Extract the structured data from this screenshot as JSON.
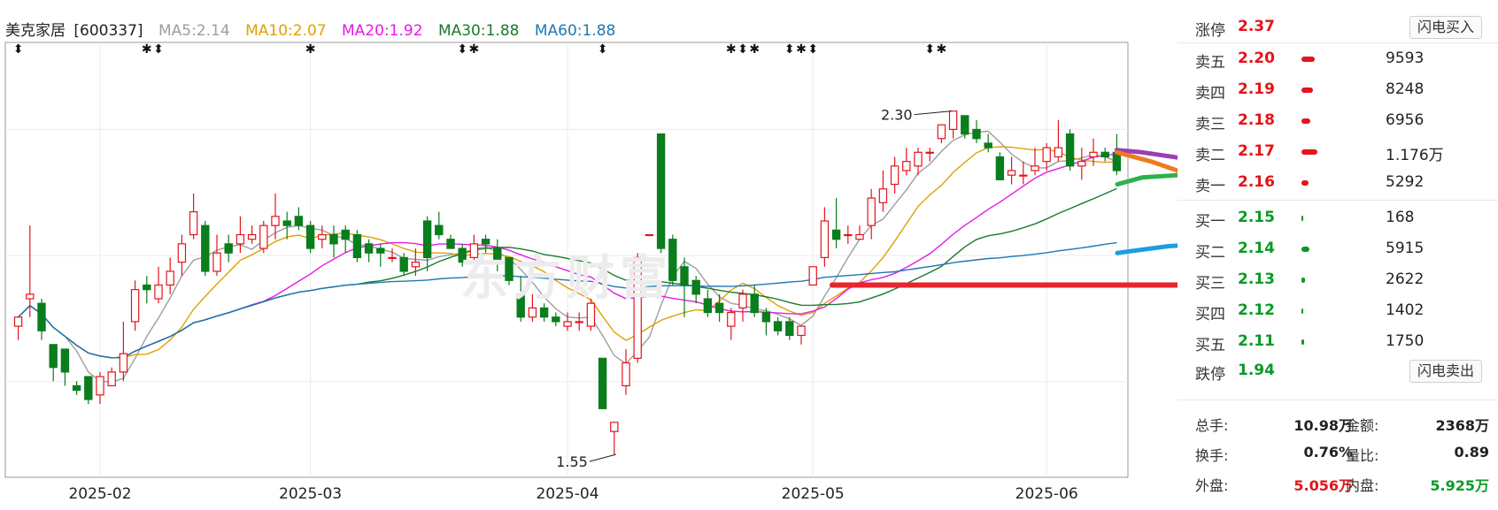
{
  "header": {
    "stock_name": "美克家居",
    "stock_code": "[600337]",
    "ma": [
      {
        "label": "MA5:2.14",
        "color": "#9e9e9e"
      },
      {
        "label": "MA10:2.07",
        "color": "#e0a000"
      },
      {
        "label": "MA20:1.92",
        "color": "#e619e6"
      },
      {
        "label": "MA30:1.88",
        "color": "#1a7a2a"
      },
      {
        "label": "MA60:1.88",
        "color": "#1f77b4"
      }
    ]
  },
  "watermark": "东方财富",
  "chart_data": {
    "type": "candlestick",
    "x_tick_labels": [
      "2025-02",
      "2025-03",
      "2025-04",
      "2025-05",
      "2025-06"
    ],
    "y_range": [
      1.5,
      2.45
    ],
    "annotations": [
      {
        "text": "2.30",
        "type": "high"
      },
      {
        "text": "1.55",
        "type": "low"
      }
    ],
    "candles": [
      [
        1.83,
        1.85,
        1.8,
        1.85
      ],
      [
        1.89,
        1.9,
        1.85,
        2.05
      ],
      [
        1.88,
        1.82,
        1.8,
        1.89
      ],
      [
        1.79,
        1.74,
        1.71,
        1.79
      ],
      [
        1.78,
        1.73,
        1.7,
        1.78
      ],
      [
        1.7,
        1.69,
        1.68,
        1.71
      ],
      [
        1.72,
        1.67,
        1.66,
        1.72
      ],
      [
        1.68,
        1.72,
        1.66,
        1.73
      ],
      [
        1.7,
        1.73,
        1.7,
        1.74
      ],
      [
        1.73,
        1.77,
        1.71,
        1.84
      ],
      [
        1.84,
        1.91,
        1.82,
        1.93
      ],
      [
        1.92,
        1.91,
        1.88,
        1.94
      ],
      [
        1.89,
        1.92,
        1.88,
        1.96
      ],
      [
        1.92,
        1.95,
        1.9,
        1.98
      ],
      [
        1.97,
        2.01,
        1.94,
        2.03
      ],
      [
        2.03,
        2.08,
        2.02,
        2.12
      ],
      [
        2.05,
        1.95,
        1.94,
        2.06
      ],
      [
        1.95,
        1.99,
        1.94,
        2.03
      ],
      [
        2.01,
        1.99,
        1.97,
        2.03
      ],
      [
        2.01,
        2.03,
        1.99,
        2.07
      ],
      [
        2.02,
        2.03,
        2.01,
        2.05
      ],
      [
        2.0,
        2.05,
        1.99,
        2.06
      ],
      [
        2.05,
        2.07,
        2.02,
        2.12
      ],
      [
        2.06,
        2.05,
        2.02,
        2.08
      ],
      [
        2.07,
        2.05,
        2.04,
        2.09
      ],
      [
        2.05,
        2.0,
        1.99,
        2.06
      ],
      [
        2.02,
        2.03,
        2.0,
        2.05
      ],
      [
        2.03,
        2.01,
        1.98,
        2.05
      ],
      [
        2.04,
        2.02,
        1.99,
        2.05
      ],
      [
        2.03,
        1.98,
        1.97,
        2.04
      ],
      [
        2.01,
        1.99,
        1.97,
        2.02
      ],
      [
        2.0,
        1.99,
        1.96,
        2.01
      ],
      [
        1.98,
        1.98,
        1.97,
        2.0
      ],
      [
        1.98,
        1.95,
        1.94,
        1.99
      ],
      [
        1.96,
        1.97,
        1.94,
        2.0
      ],
      [
        2.06,
        1.98,
        1.95,
        2.07
      ],
      [
        2.05,
        2.03,
        2.02,
        2.08
      ],
      [
        2.02,
        2.0,
        2.0,
        2.03
      ],
      [
        2.0,
        1.97,
        1.96,
        2.01
      ],
      [
        1.98,
        2.01,
        1.97,
        2.03
      ],
      [
        2.02,
        2.01,
        1.99,
        2.03
      ],
      [
        2.0,
        1.97,
        1.95,
        2.02
      ],
      [
        1.98,
        1.93,
        1.92,
        1.98
      ],
      [
        1.9,
        1.85,
        1.84,
        1.94
      ],
      [
        1.85,
        1.87,
        1.84,
        1.9
      ],
      [
        1.87,
        1.85,
        1.84,
        1.88
      ],
      [
        1.85,
        1.84,
        1.83,
        1.86
      ],
      [
        1.83,
        1.84,
        1.82,
        1.86
      ],
      [
        1.84,
        1.84,
        1.82,
        1.86
      ],
      [
        1.83,
        1.88,
        1.82,
        1.89
      ],
      [
        1.76,
        1.65,
        1.65,
        1.76
      ],
      [
        1.6,
        1.62,
        1.55,
        1.6
      ],
      [
        1.7,
        1.75,
        1.68,
        1.78
      ],
      [
        1.76,
        1.98,
        1.75,
        1.99
      ],
      [
        2.03,
        2.03,
        2.03,
        2.03
      ],
      [
        2.25,
        2.0,
        1.99,
        2.25
      ],
      [
        2.02,
        1.93,
        1.92,
        2.03
      ],
      [
        1.96,
        1.92,
        1.85,
        1.98
      ],
      [
        1.93,
        1.9,
        1.88,
        1.94
      ],
      [
        1.89,
        1.86,
        1.85,
        1.91
      ],
      [
        1.88,
        1.86,
        1.84,
        1.9
      ],
      [
        1.83,
        1.86,
        1.8,
        1.87
      ],
      [
        1.87,
        1.9,
        1.84,
        1.91
      ],
      [
        1.9,
        1.86,
        1.85,
        1.92
      ],
      [
        1.86,
        1.84,
        1.81,
        1.87
      ],
      [
        1.84,
        1.82,
        1.81,
        1.85
      ],
      [
        1.84,
        1.81,
        1.8,
        1.85
      ],
      [
        1.81,
        1.83,
        1.79,
        1.83
      ],
      [
        1.92,
        1.96,
        1.92,
        1.96
      ],
      [
        1.98,
        2.06,
        1.96,
        2.09
      ],
      [
        2.04,
        2.02,
        2.0,
        2.11
      ],
      [
        2.03,
        2.03,
        2.01,
        2.05
      ],
      [
        2.02,
        2.03,
        2.02,
        2.05
      ],
      [
        2.05,
        2.11,
        2.02,
        2.13
      ],
      [
        2.1,
        2.13,
        2.08,
        2.17
      ],
      [
        2.14,
        2.18,
        2.12,
        2.2
      ],
      [
        2.17,
        2.19,
        2.16,
        2.22
      ],
      [
        2.18,
        2.21,
        2.16,
        2.22
      ],
      [
        2.21,
        2.21,
        2.19,
        2.22
      ],
      [
        2.24,
        2.27,
        2.23,
        2.27
      ],
      [
        2.26,
        2.3,
        2.24,
        2.3
      ],
      [
        2.29,
        2.25,
        2.24,
        2.29
      ],
      [
        2.26,
        2.24,
        2.23,
        2.28
      ],
      [
        2.23,
        2.22,
        2.21,
        2.25
      ],
      [
        2.2,
        2.15,
        2.15,
        2.21
      ],
      [
        2.16,
        2.17,
        2.14,
        2.2
      ],
      [
        2.16,
        2.16,
        2.14,
        2.19
      ],
      [
        2.17,
        2.18,
        2.16,
        2.22
      ],
      [
        2.19,
        2.22,
        2.17,
        2.23
      ],
      [
        2.2,
        2.22,
        2.19,
        2.28
      ],
      [
        2.25,
        2.18,
        2.17,
        2.26
      ],
      [
        2.18,
        2.19,
        2.15,
        2.22
      ],
      [
        2.2,
        2.21,
        2.18,
        2.24
      ],
      [
        2.21,
        2.2,
        2.19,
        2.22
      ],
      [
        2.21,
        2.17,
        2.16,
        2.25
      ]
    ],
    "overlay_strokes": [
      {
        "color": "#e6252c",
        "points": [
          [
            1.92,
            1.92
          ],
          [
            2.75,
            1.92
          ]
        ],
        "note": "support line"
      }
    ]
  },
  "panel": {
    "limit_up": {
      "label": "涨停",
      "price": "2.37",
      "button": "闪电买入"
    },
    "limit_down": {
      "label": "跌停",
      "price": "1.94",
      "button": "闪电卖出"
    },
    "asks": [
      {
        "label": "卖五",
        "price": "2.20",
        "vol": "9593",
        "bar": 0.22
      },
      {
        "label": "卖四",
        "price": "2.19",
        "vol": "8248",
        "bar": 0.18
      },
      {
        "label": "卖三",
        "price": "2.18",
        "vol": "6956",
        "bar": 0.14
      },
      {
        "label": "卖二",
        "price": "2.17",
        "vol": "1.176万",
        "bar": 0.26
      },
      {
        "label": "卖一",
        "price": "2.16",
        "vol": "5292",
        "bar": 0.12
      }
    ],
    "bids": [
      {
        "label": "买一",
        "price": "2.15",
        "vol": "168",
        "bar": 0.02
      },
      {
        "label": "买二",
        "price": "2.14",
        "vol": "5915",
        "bar": 0.13
      },
      {
        "label": "买三",
        "price": "2.13",
        "vol": "2622",
        "bar": 0.06
      },
      {
        "label": "买四",
        "price": "2.12",
        "vol": "1402",
        "bar": 0.03
      },
      {
        "label": "买五",
        "price": "2.11",
        "vol": "1750",
        "bar": 0.04
      }
    ],
    "stats": {
      "total_hands_label": "总手:",
      "total_hands": "10.98万",
      "amount_label": "金额:",
      "amount": "2368万",
      "turnover_label": "换手:",
      "turnover": "0.76%",
      "vol_ratio_label": "量比:",
      "vol_ratio": "0.89",
      "outer_label": "外盘:",
      "outer": "5.056万",
      "inner_label": "内盘:",
      "inner": "5.925万"
    }
  }
}
